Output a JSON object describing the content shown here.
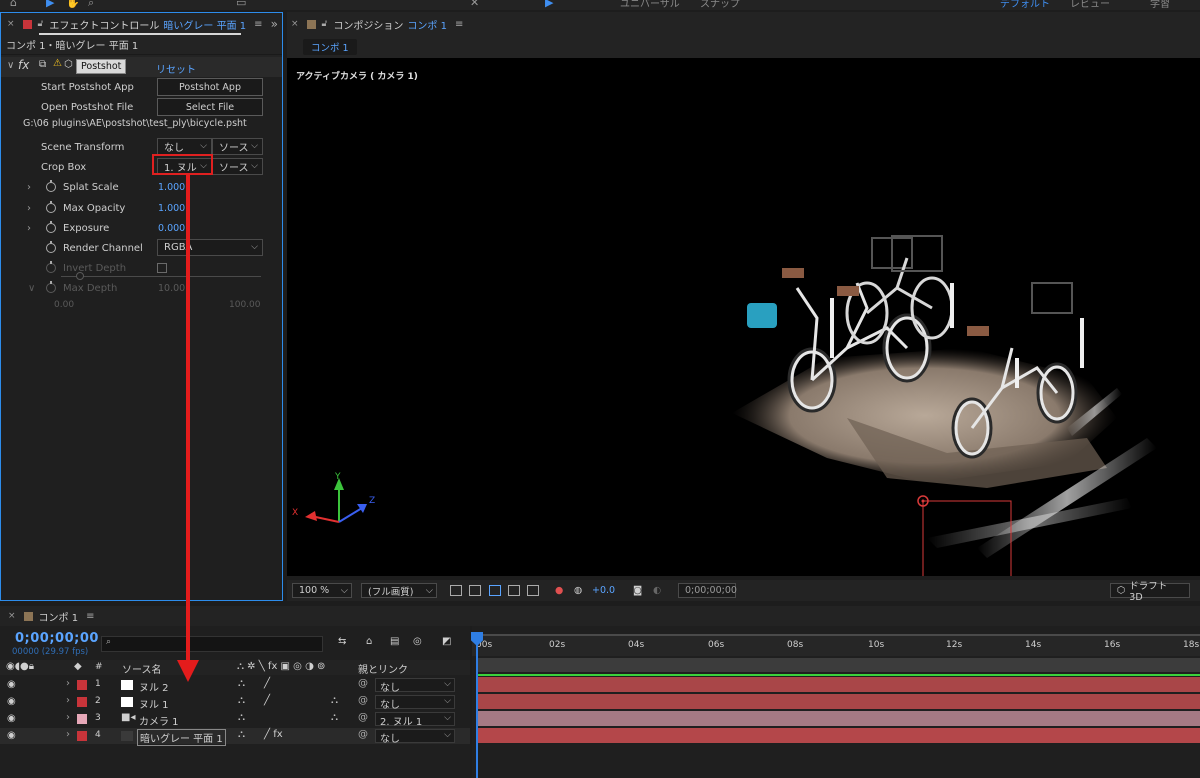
{
  "toolbar": {
    "workspace_default": "デフォルト",
    "workspace_review": "レビュー",
    "workspace_learn": "学習",
    "universal_label": "ユニバーサル",
    "snap_label": "スナップ"
  },
  "effect_controls": {
    "tab_prefix": "エフェクトコントロール",
    "tab_layer": "暗いグレー 平面 1",
    "swatch_color": "#c8343a",
    "subheader": "コンポ 1・暗いグレー 平面 1",
    "effect_name": "Postshot",
    "reset_label": "リセット",
    "start_app_label": "Start Postshot App",
    "start_app_button": "Postshot App",
    "open_file_label": "Open Postshot File",
    "open_file_button": "Select File",
    "file_path": "G:\\06 plugins\\AE\\postshot\\test_ply\\bicycle.psht",
    "scene_transform_label": "Scene Transform",
    "scene_transform_value": "なし",
    "scene_transform_source": "ソース",
    "crop_box_label": "Crop Box",
    "crop_box_value": "1. ヌル",
    "crop_box_source": "ソース",
    "splat_scale_label": "Splat Scale",
    "splat_scale_value": "1.000",
    "max_opacity_label": "Max Opacity",
    "max_opacity_value": "1.000",
    "exposure_label": "Exposure",
    "exposure_value": "0.000",
    "render_channel_label": "Render Channel",
    "render_channel_value": "RGBA",
    "invert_depth_label": "Invert Depth",
    "max_depth_label": "Max Depth",
    "max_depth_value": "10.00",
    "slider_min": "0.00",
    "slider_max": "100.00"
  },
  "composition": {
    "tab_prefix": "コンポジション",
    "tab_name": "コンポ 1",
    "sub_tab": "コンポ 1",
    "camera_label": "アクティブカメラ ( カメラ 1)",
    "axis_x": "X",
    "axis_y": "Y",
    "axis_z": "Z",
    "zoom": "100 %",
    "quality": "(フル画質)",
    "exposure_value": "+0.0",
    "timecode": "0;00;00;00",
    "draft_label": "ドラフト 3D"
  },
  "timeline": {
    "tab_name": "コンポ 1",
    "timecode": "0;00;00;00",
    "fps": "00000 (29.97 fps)",
    "search_placeholder": "⌕",
    "col_source_name": "ソース名",
    "col_parent": "親とリンク",
    "col_hash": "#",
    "ruler_ticks": [
      "00s",
      "02s",
      "04s",
      "06s",
      "08s",
      "10s",
      "12s",
      "14s",
      "16s",
      "18s"
    ],
    "layers": [
      {
        "num": "1",
        "name": "ヌル 2",
        "label_color": "#c8343a",
        "parent": "なし",
        "bar_color": "#a94648"
      },
      {
        "num": "2",
        "name": "ヌル 1",
        "label_color": "#c8343a",
        "parent": "なし",
        "bar_color": "#a94648"
      },
      {
        "num": "3",
        "name": "カメラ 1",
        "label_color": "#e6a8b8",
        "parent": "2. ヌル 1",
        "bar_color": "#a57a84"
      },
      {
        "num": "4",
        "name": "暗いグレー 平面 1",
        "label_color": "#c8343a",
        "parent": "なし",
        "bar_color": "#b4474a"
      }
    ]
  }
}
